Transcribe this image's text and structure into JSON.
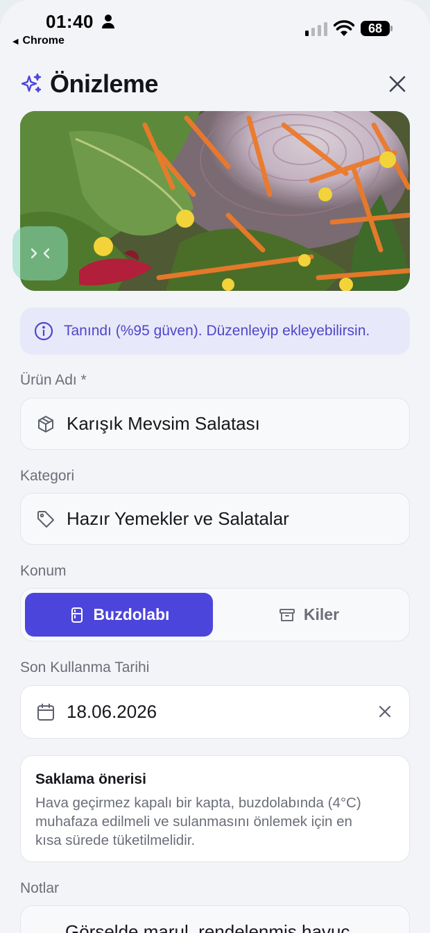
{
  "status_bar": {
    "time": "01:40",
    "back_app": "Chrome",
    "battery": "68"
  },
  "header": {
    "title": "Önizleme",
    "icon": "sparkles-icon",
    "close_icon": "close-icon"
  },
  "banner": {
    "text": "Tanındı (%95 güven). Düzenleyip ekleyebilirsin.",
    "icon": "info-icon"
  },
  "form": {
    "product_name": {
      "label": "Ürün Adı *",
      "value": "Karışık Mevsim Salatası",
      "icon": "package-icon"
    },
    "category": {
      "label": "Kategori",
      "value": "Hazır Yemekler ve Salatalar",
      "icon": "tag-icon"
    },
    "location": {
      "label": "Konum",
      "options": [
        "Buzdolabı",
        "Kiler"
      ],
      "selected": "Buzdolabı"
    },
    "expiry": {
      "label": "Son Kullanma Tarihi",
      "value": "18.06.2026",
      "icon": "calendar-icon"
    },
    "storage_tip": {
      "title": "Saklama önerisi",
      "body": [
        "Hava geçirmez kapalı bir kapta, buzdolabında (4°C)",
        "muhafaza edilmeli ve sulanmasını önlemek için en",
        "kısa sürede tüketilmelidir."
      ]
    },
    "notes": {
      "label": "Notlar",
      "value": "Görselde marul, rendelenmiş havuç"
    }
  },
  "colors": {
    "accent": "#4c45dc",
    "banner_bg": "#e8e8fb",
    "banner_text": "#4f46c8"
  }
}
